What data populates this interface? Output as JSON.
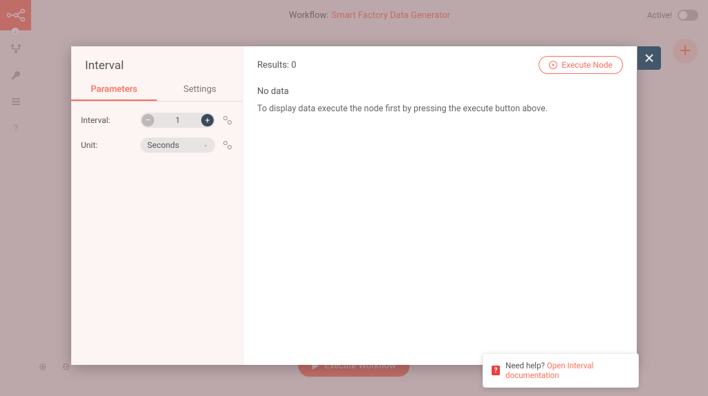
{
  "colors": {
    "accent": "#ff6d5a"
  },
  "sidebar": {
    "icons": [
      "workflows-icon",
      "credentials-icon",
      "executions-icon",
      "help-icon"
    ]
  },
  "header": {
    "workflow_prefix": "Workflow:",
    "workflow_name": "Smart Factory Data Generator",
    "active_label": "Active!",
    "active_state": false
  },
  "bottom": {
    "execute_workflow_label": "Execute Workflow"
  },
  "modal": {
    "title": "Interval",
    "tabs": {
      "parameters": "Parameters",
      "settings": "Settings"
    },
    "active_tab": "parameters",
    "form": {
      "interval": {
        "label": "Interval:",
        "value": "1"
      },
      "unit": {
        "label": "Unit:",
        "selected": "Seconds"
      }
    },
    "results": {
      "label": "Results: 0",
      "execute_label": "Execute Node",
      "nodata_title": "No data",
      "nodata_sub": "To display data execute the node first by pressing the execute button above."
    }
  },
  "help": {
    "text": "Need help?",
    "link": "Open Interval documentation"
  }
}
